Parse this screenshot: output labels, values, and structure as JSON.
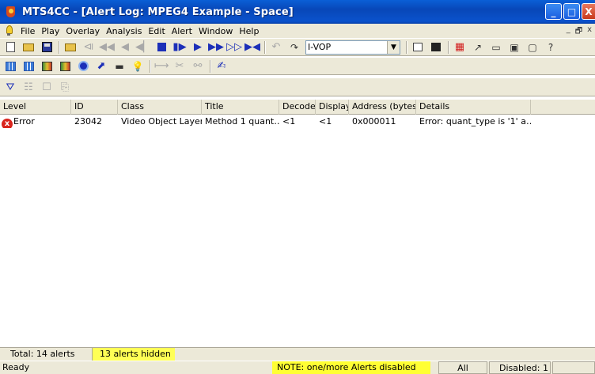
{
  "window": {
    "title": "MTS4CC - [Alert Log: MPEG4 Example - Space]",
    "app_icon": "mts4cc-app-icon",
    "controls": [
      "_",
      "□",
      "X"
    ]
  },
  "menubar": {
    "items": [
      "File",
      "Play",
      "Overlay",
      "Analysis",
      "Edit",
      "Alert",
      "Window",
      "Help"
    ],
    "mdi_controls": [
      "_",
      "🗗",
      "x"
    ]
  },
  "toolbar": {
    "vop_select": "I-VOP"
  },
  "list": {
    "columns": [
      "Level",
      "ID",
      "Class",
      "Title",
      "Decode",
      "Display",
      "Address (bytes)",
      "Details"
    ],
    "rows": [
      {
        "level": "Error",
        "level_icon": "error-icon",
        "id": "23042",
        "class": "Video Object Layer",
        "title": "Method 1 quant…",
        "decode": "<1",
        "display": "<1",
        "address": "0x000011",
        "details": "Error: quant_type is '1' a…"
      }
    ]
  },
  "summary": {
    "total": "Total: 14 alerts",
    "hidden": "13 alerts hidden"
  },
  "status": {
    "ready": "Ready",
    "note": "NOTE: one/more Alerts disabled",
    "all": "All",
    "disabled": "Disabled: 1"
  },
  "colors": {
    "titlebar": "#0a52cc",
    "chrome": "#ece9d8",
    "highlight": "#ffff55",
    "error": "#d9251d"
  }
}
